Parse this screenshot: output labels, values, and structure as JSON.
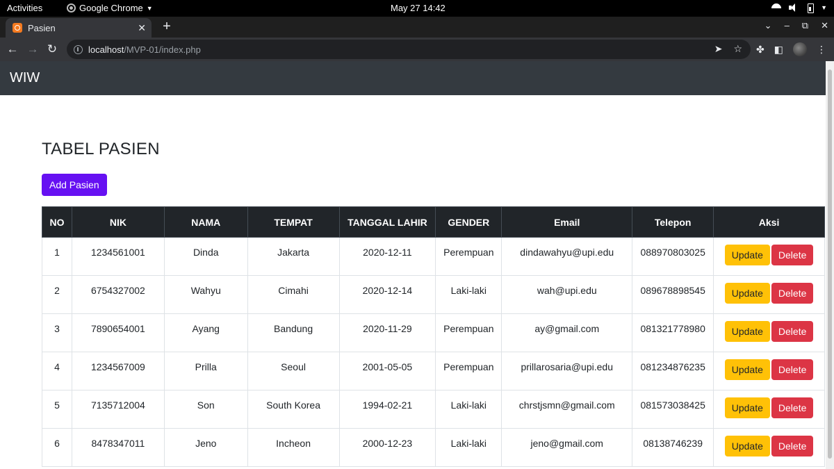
{
  "system_bar": {
    "activities": "Activities",
    "app_name": "Google Chrome",
    "clock": "May 27  14:42"
  },
  "browser": {
    "tab_title": "Pasien",
    "url_host": "localhost",
    "url_path": "/MVP-01/index.php"
  },
  "navbar": {
    "brand": "WIW"
  },
  "page": {
    "title": "TABEL PASIEN",
    "add_button": "Add Pasien"
  },
  "table": {
    "headers": [
      "NO",
      "NIK",
      "NAMA",
      "TEMPAT",
      "TANGGAL LAHIR",
      "GENDER",
      "Email",
      "Telepon",
      "Aksi"
    ],
    "update_label": "Update",
    "delete_label": "Delete",
    "rows": [
      [
        "1",
        "1234561001",
        "Dinda",
        "Jakarta",
        "2020-12-11",
        "Perempuan",
        "dindawahyu@upi.edu",
        "088970803025"
      ],
      [
        "2",
        "6754327002",
        "Wahyu",
        "Cimahi",
        "2020-12-14",
        "Laki-laki",
        "wah@upi.edu",
        "089678898545"
      ],
      [
        "3",
        "7890654001",
        "Ayang",
        "Bandung",
        "2020-11-29",
        "Perempuan",
        "ay@gmail.com",
        "081321778980"
      ],
      [
        "4",
        "1234567009",
        "Prilla",
        "Seoul",
        "2001-05-05",
        "Perempuan",
        "prillarosaria@upi.edu",
        "081234876235"
      ],
      [
        "5",
        "7135712004",
        "Son",
        "South Korea",
        "1994-02-21",
        "Laki-laki",
        "chrstjsmn@gmail.com",
        "081573038425"
      ],
      [
        "6",
        "8478347011",
        "Jeno",
        "Incheon",
        "2000-12-23",
        "Laki-laki",
        "jeno@gmail.com",
        "08138746239"
      ]
    ]
  }
}
